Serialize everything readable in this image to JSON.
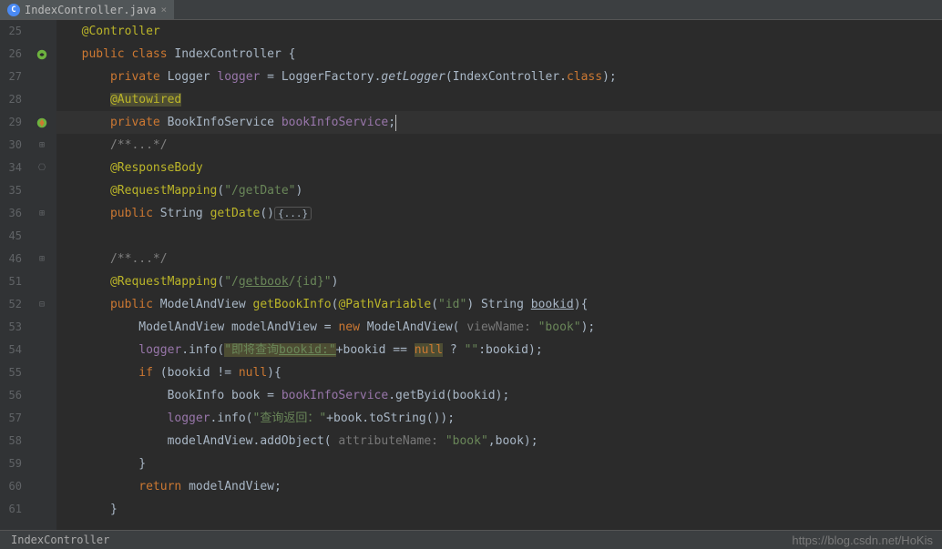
{
  "tab": {
    "filename": "IndexController.java",
    "icon_letter": "C"
  },
  "line_numbers": [
    "25",
    "26",
    "27",
    "28",
    "29",
    "30",
    "34",
    "35",
    "36",
    "45",
    "46",
    "51",
    "52",
    "53",
    "54",
    "55",
    "56",
    "57",
    "58",
    "59",
    "60",
    "61"
  ],
  "code": {
    "l25": "@Controller",
    "l26_kw1": "public class ",
    "l26_name": "IndexController ",
    "l26_brace": "{",
    "l27_kw": "private ",
    "l27_type": "Logger ",
    "l27_field": "logger",
    "l27_eq": " = LoggerFactory.",
    "l27_m": "getLogger",
    "l27_arg": "(IndexController.",
    "l27_cls": "class",
    "l27_end": ");",
    "l28": "@Autowired",
    "l29_kw": "private ",
    "l29_type": "BookInfoService ",
    "l29_field": "bookInfoService",
    "l29_end": ";",
    "l30": "/**...*/",
    "l34": "@ResponseBody",
    "l35_ann": "@RequestMapping",
    "l35_p": "(",
    "l35_str": "\"/getDate\"",
    "l35_p2": ")",
    "l36_kw": "public ",
    "l36_type": "String ",
    "l36_m": "getDate",
    "l36_p": "()",
    "l36_fold": "{...}",
    "l46": "/**...*/",
    "l51_ann": "@RequestMapping",
    "l51_p": "(",
    "l51_s1": "\"/",
    "l51_s2": "getbook",
    "l51_s3": "/{id}\"",
    "l51_p2": ")",
    "l52_kw": "public ",
    "l52_type": "ModelAndView ",
    "l52_m": "getBookInfo",
    "l52_p": "(",
    "l52_ann": "@PathVariable",
    "l52_p2": "(",
    "l52_str": "\"id\"",
    "l52_p3": ") String ",
    "l52_param": "bookid",
    "l52_end": "){",
    "l53_a": "ModelAndView modelAndView = ",
    "l53_kw": "new ",
    "l53_b": "ModelAndView(",
    "l53_hint": " viewName: ",
    "l53_str": "\"book\"",
    "l53_end": ");",
    "l54_a": "logger",
    "l54_b": ".info(",
    "l54_s1": "\"即将查询",
    "l54_s2": "bookid:\"",
    "l54_c": "+bookid == ",
    "l54_null": "null",
    "l54_d": " ? ",
    "l54_s3": "\"\"",
    "l54_e": ":bookid);",
    "l55_kw": "if ",
    "l55_a": "(bookid != ",
    "l55_null": "null",
    "l55_b": "){",
    "l56_a": "BookInfo book = ",
    "l56_f": "bookInfoService",
    "l56_b": ".getByid(bookid);",
    "l57_f": "logger",
    "l57_a": ".info(",
    "l57_s": "\"查询返回：\"",
    "l57_b": "+book.toString());",
    "l58_a": "modelAndView.addObject(",
    "l58_hint": " attributeName: ",
    "l58_s": "\"book\"",
    "l58_b": ",book);",
    "l59": "}",
    "l60_kw": "return ",
    "l60_a": "modelAndView;",
    "l61": "}"
  },
  "breadcrumb": "IndexController",
  "watermark": "https://blog.csdn.net/HoKis"
}
